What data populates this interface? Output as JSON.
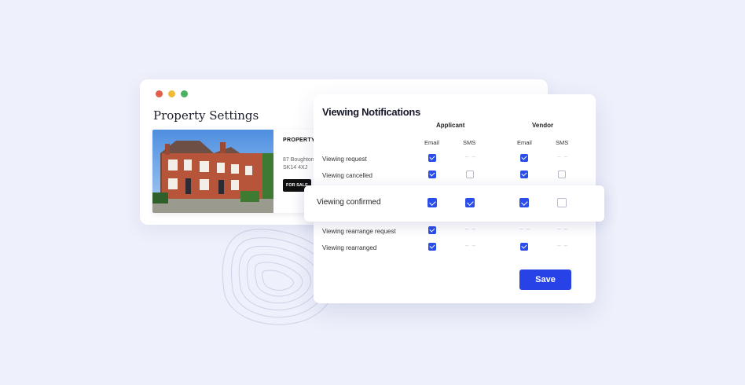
{
  "property_window": {
    "title": "Property Settings",
    "card": {
      "label": "PROPERTY",
      "address_line1": "87 Boughton",
      "address_line2": "SK14 4XJ",
      "badge": "FOR SALE"
    }
  },
  "notifications": {
    "title": "Viewing Notifications",
    "groups": [
      "Applicant",
      "Vendor"
    ],
    "columns": [
      "Email",
      "SMS",
      "Email",
      "SMS"
    ],
    "rows": [
      {
        "label": "Viewing request",
        "applicant_email": "checked",
        "applicant_sms": "n/a",
        "vendor_email": "checked",
        "vendor_sms": "n/a"
      },
      {
        "label": "Viewing cancelled",
        "applicant_email": "checked",
        "applicant_sms": "unchecked",
        "vendor_email": "checked",
        "vendor_sms": "unchecked"
      },
      {
        "label": "Viewing confirmed",
        "applicant_email": "checked",
        "applicant_sms": "checked",
        "vendor_email": "checked",
        "vendor_sms": "unchecked"
      },
      {
        "label": "Viewing rearrange request",
        "applicant_email": "checked",
        "applicant_sms": "n/a",
        "vendor_email": "n/a",
        "vendor_sms": "n/a"
      },
      {
        "label": "Viewing rearranged",
        "applicant_email": "checked",
        "applicant_sms": "n/a",
        "vendor_email": "checked",
        "vendor_sms": "n/a"
      }
    ],
    "na_symbol": "– –",
    "save_label": "Save"
  },
  "colors": {
    "accent": "#2742e6",
    "checkbox_on": "#2b4de8",
    "background": "#eef0fb"
  }
}
